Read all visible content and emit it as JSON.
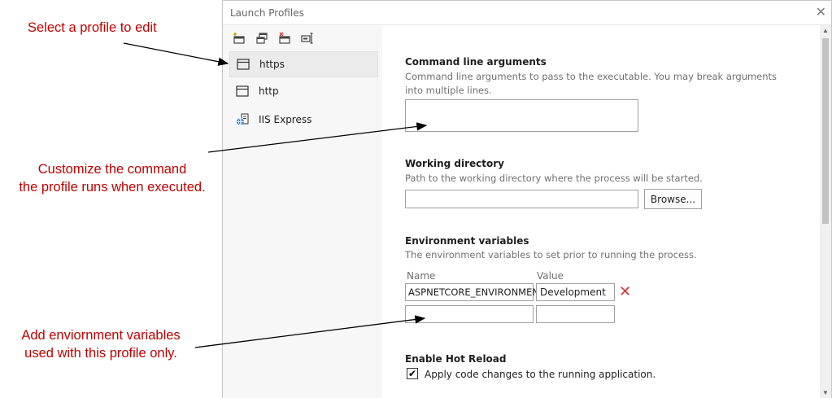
{
  "annotations": {
    "select": "Select a profile to edit",
    "customize_line1": "Customize the command",
    "customize_line2": "the profile runs when executed.",
    "env_line1": "Add enviornment variables",
    "env_line2": "used with this profile only."
  },
  "window": {
    "title": "Launch Profiles",
    "close": "✕"
  },
  "toolbar": {
    "buttons": [
      {
        "icon": "new-profile-icon"
      },
      {
        "icon": "duplicate-profile-icon"
      },
      {
        "icon": "delete-profile-icon"
      },
      {
        "icon": "rename-profile-icon"
      }
    ]
  },
  "profiles": [
    {
      "label": "https",
      "icon": "window-icon",
      "selected": true
    },
    {
      "label": "http",
      "icon": "window-icon",
      "selected": false
    },
    {
      "label": "IIS Express",
      "icon": "globe-server-icon",
      "selected": false
    }
  ],
  "command_line": {
    "title": "Command line arguments",
    "description": "Command line arguments to pass to the executable. You may break arguments into multiple lines.",
    "value": ""
  },
  "working_directory": {
    "title": "Working directory",
    "description": "Path to the working directory where the process will be started.",
    "value": "",
    "browse_label": "Browse..."
  },
  "environment": {
    "title": "Environment variables",
    "description": "The environment variables to set prior to running the process.",
    "name_header": "Name",
    "value_header": "Value",
    "rows": [
      {
        "name": "ASPNETCORE_ENVIRONMENT",
        "value": "Development"
      }
    ],
    "new_row": {
      "name": "",
      "value": ""
    }
  },
  "hot_reload": {
    "title": "Enable Hot Reload",
    "checkbox_label": "Apply code changes to the running application.",
    "checked": true
  },
  "colors": {
    "annotation": "#c00000",
    "delete": "#d13438"
  }
}
